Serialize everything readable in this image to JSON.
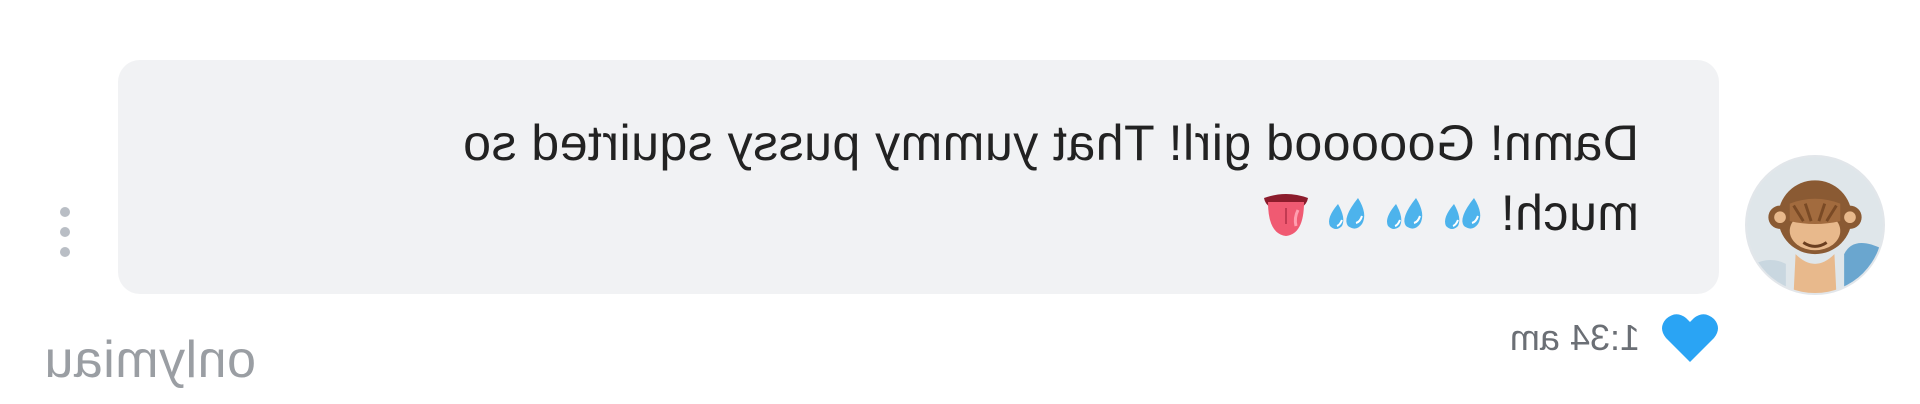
{
  "message": {
    "text_line1": "Damn! Goooood girl! That yummy pussy squirted so",
    "text_line2": "much! ",
    "emojis": [
      "sweat-droplets-emoji",
      "sweat-droplets-emoji",
      "sweat-droplets-emoji",
      "tongue-emoji"
    ],
    "timestamp": "1:34 am",
    "liked": true
  },
  "avatar": {
    "emoji": "see-no-evil-monkey"
  },
  "watermark": "onlymiau",
  "colors": {
    "bubble": "#f1f2f4",
    "text": "#222222",
    "heart": "#2aa4f4",
    "timestamp": "#6b6f75",
    "watermark": "#9a9ea3",
    "dots": "#b9bec5"
  }
}
